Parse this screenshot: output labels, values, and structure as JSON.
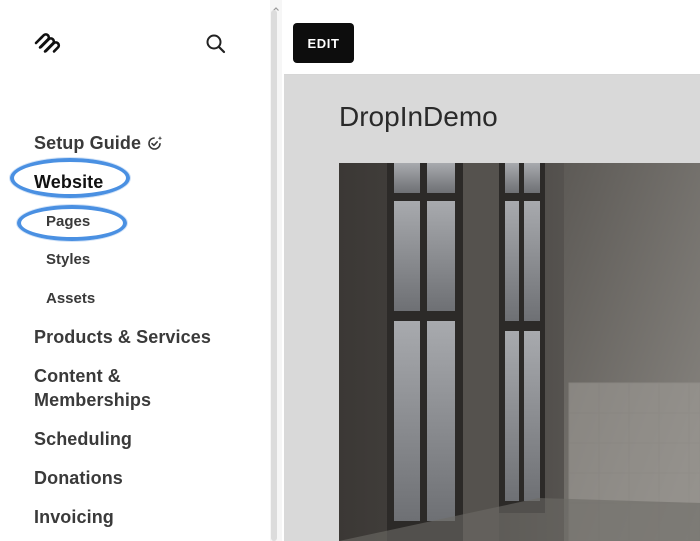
{
  "sidebar": {
    "logo_icon": "squarespace-logo-icon",
    "search_icon": "search-icon",
    "setup_guide": "Setup Guide",
    "website": "Website",
    "pages": "Pages",
    "styles": "Styles",
    "assets": "Assets",
    "products": "Products & Services",
    "content_line1": "Content &",
    "content_line2": "Memberships",
    "scheduling": "Scheduling",
    "donations": "Donations",
    "invoicing": "Invoicing"
  },
  "toolbar": {
    "edit_label": "EDIT"
  },
  "preview": {
    "site_title": "DropInDemo"
  },
  "colors": {
    "highlight": "#4a90e2",
    "edit_button": "#0d0d0d",
    "preview_bg": "#d9d9d9"
  }
}
